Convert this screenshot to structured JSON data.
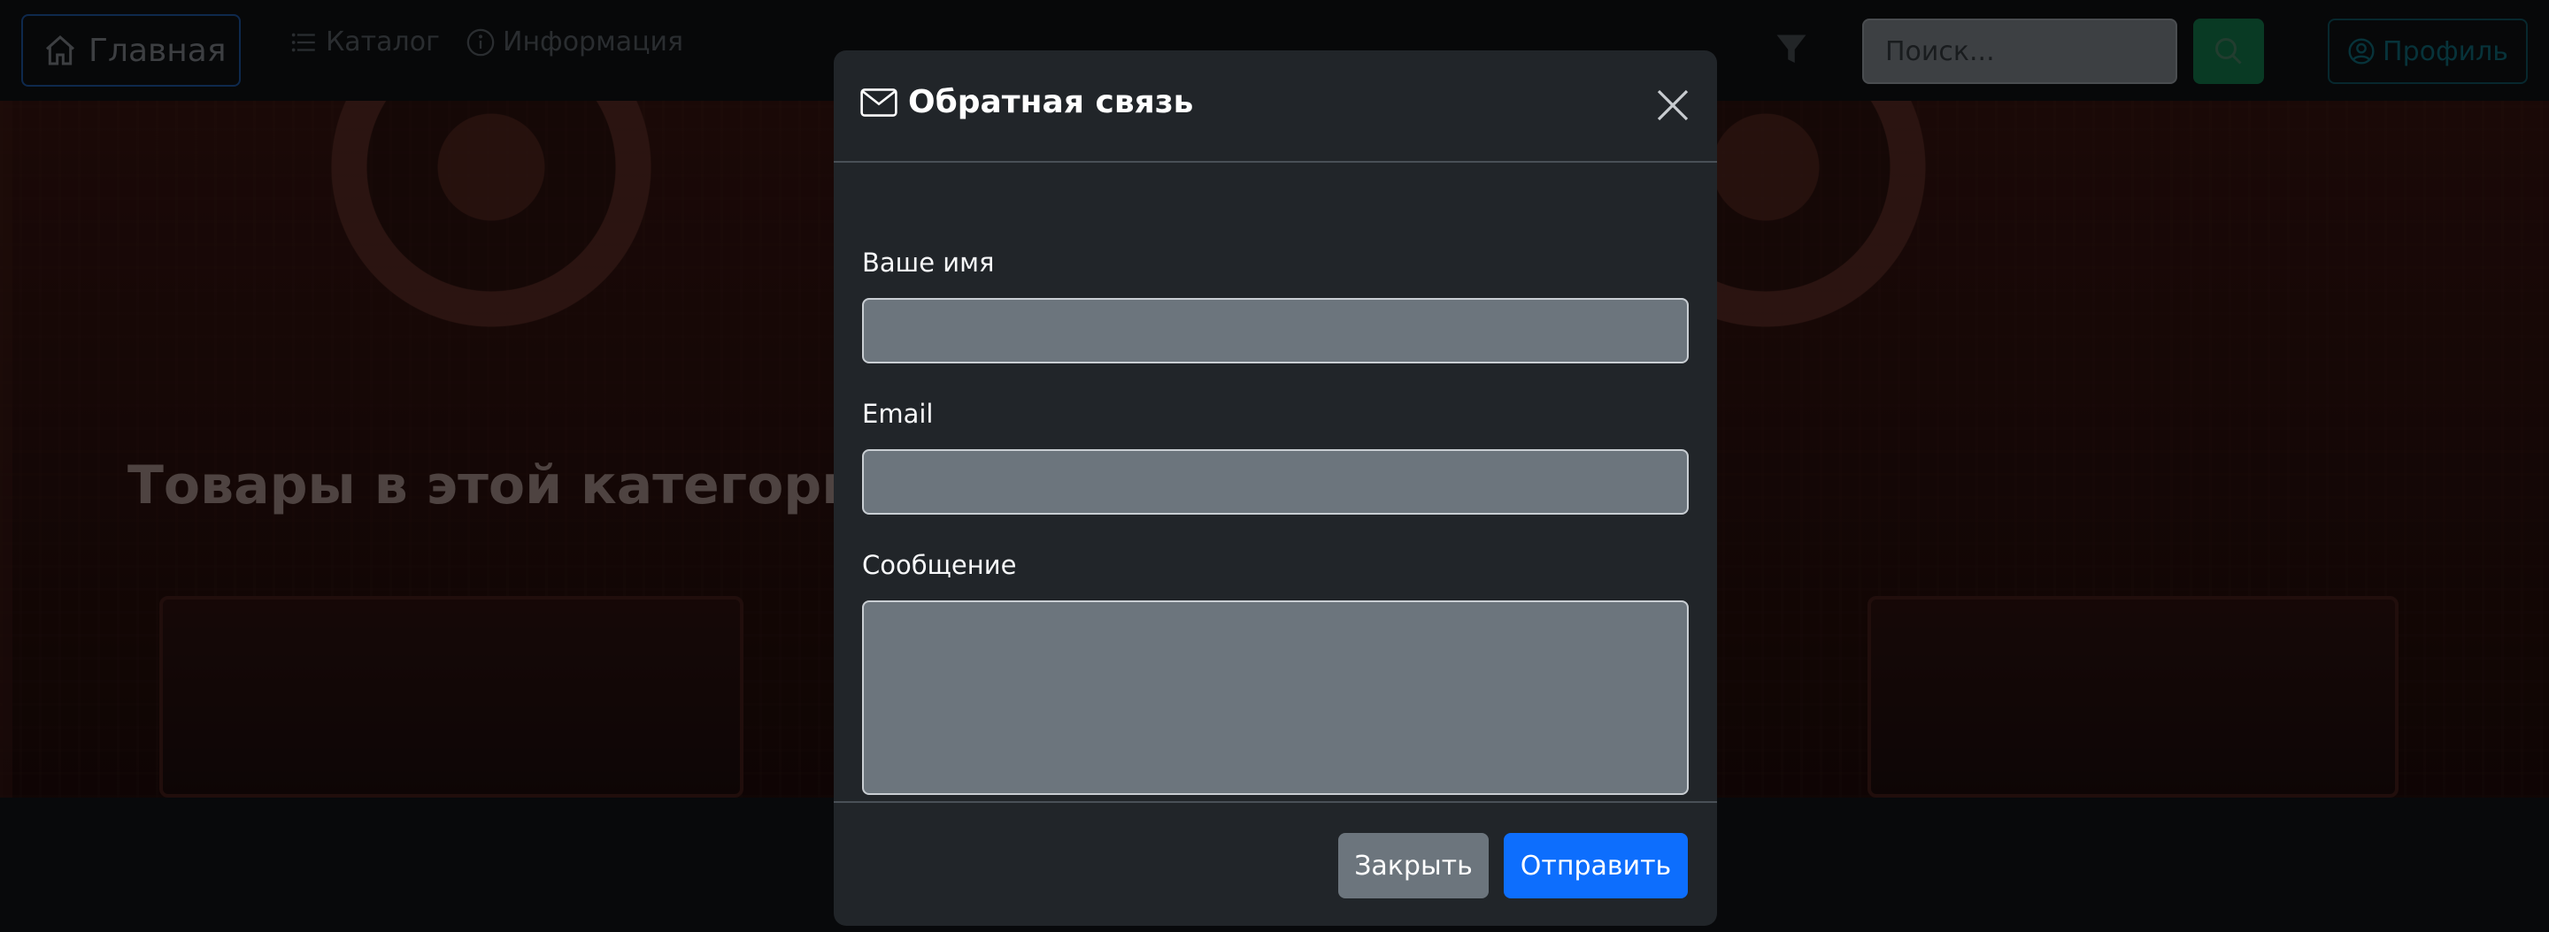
{
  "navbar": {
    "brand_label": "Главная",
    "links": [
      {
        "label": "Каталог",
        "icon": "list-icon"
      },
      {
        "label": "Информация",
        "icon": "info-circle-icon"
      }
    ],
    "search": {
      "placeholder": "Поиск...",
      "value": ""
    },
    "profile_label": "Профиль",
    "colors": {
      "search_button": "#198754",
      "profile_outline": "#0dcaf0",
      "brand_outline": "#0d6efd"
    }
  },
  "hero": {
    "heading": "Товары в этой категории в"
  },
  "modal": {
    "title": "Обратная связь",
    "title_icon": "envelope-icon",
    "fields": [
      {
        "label": "Ваше имя",
        "value": ""
      },
      {
        "label": "Email",
        "value": ""
      },
      {
        "label": "Сообщение",
        "value": ""
      }
    ],
    "buttons": {
      "close_label": "Закрыть",
      "send_label": "Отправить"
    },
    "colors": {
      "background": "#212529",
      "input": "#6c757d",
      "primary": "#0d6efd",
      "secondary": "#6c757d"
    }
  }
}
